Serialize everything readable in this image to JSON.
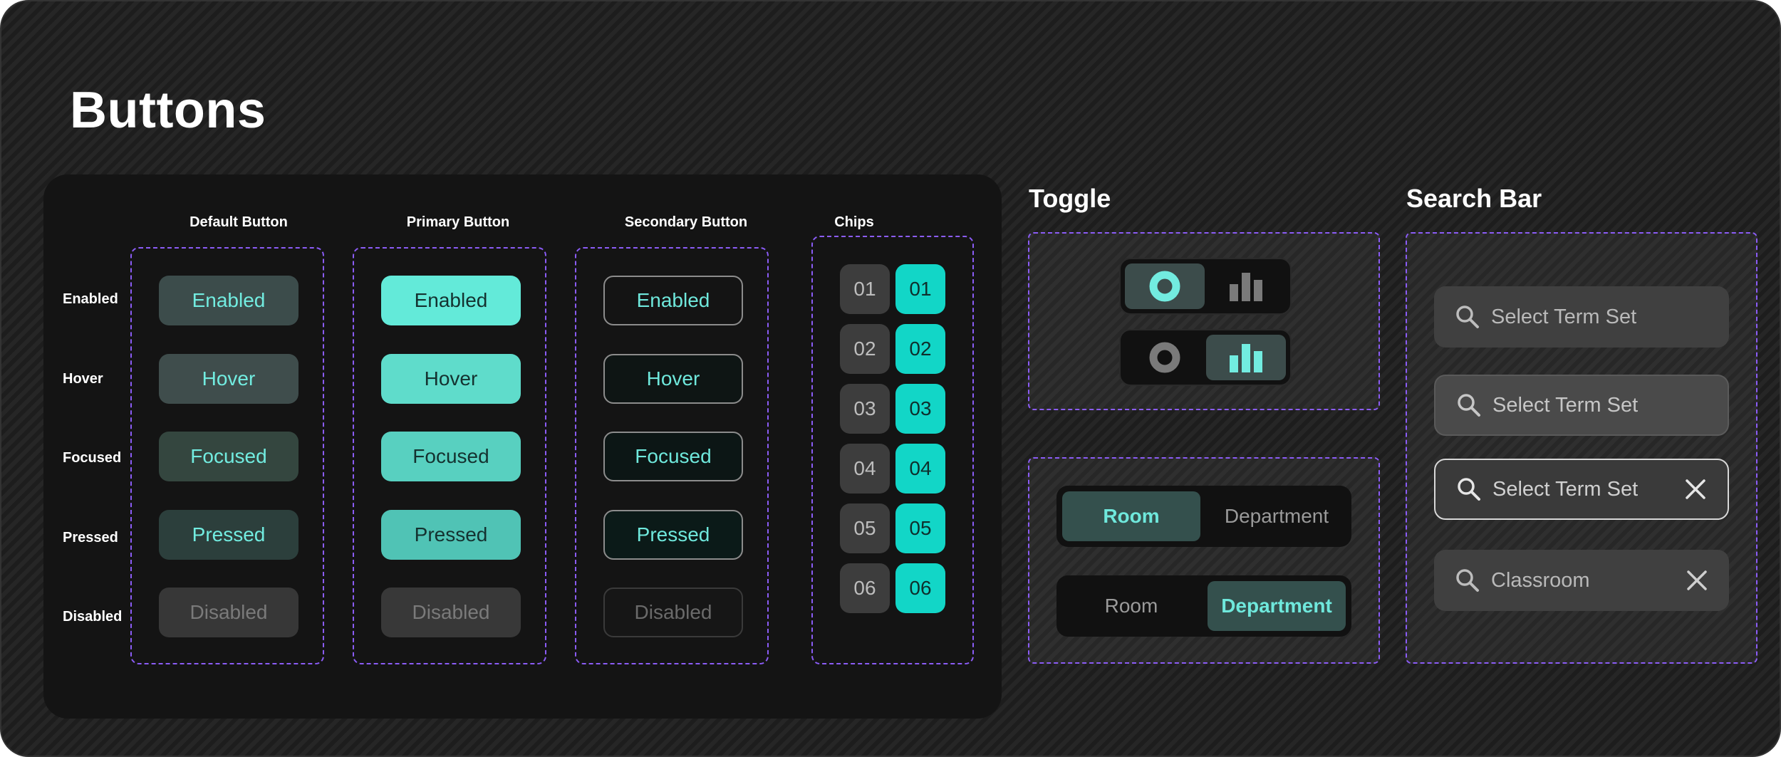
{
  "page": {
    "title": "Buttons"
  },
  "buttons_card": {
    "columns": [
      "Default Button",
      "Primary Button",
      "Secondary Button",
      "Chips"
    ],
    "rows": [
      "Enabled",
      "Hover",
      "Focused",
      "Pressed",
      "Disabled"
    ],
    "default_buttons": [
      "Enabled",
      "Hover",
      "Focused",
      "Pressed",
      "Disabled"
    ],
    "primary_buttons": [
      "Enabled",
      "Hover",
      "Focused",
      "Pressed",
      "Disabled"
    ],
    "secondary_buttons": [
      "Enabled",
      "Hover",
      "Focused",
      "Pressed",
      "Disabled"
    ],
    "chips": [
      "01",
      "02",
      "03",
      "04",
      "05",
      "06"
    ]
  },
  "toggle": {
    "title": "Toggle",
    "icons": [
      "record-icon",
      "bar-chart-icon"
    ],
    "segments": [
      {
        "left": "Room",
        "right": "Department",
        "active": "left"
      },
      {
        "left": "Room",
        "right": "Department",
        "active": "right"
      }
    ]
  },
  "search_bar": {
    "title": "Search Bar",
    "items": [
      {
        "text": "Select Term Set",
        "state": "enabled",
        "clear": false
      },
      {
        "text": "Select Term Set",
        "state": "hover",
        "clear": false
      },
      {
        "text": "Select Term Set",
        "state": "focused",
        "clear": true
      },
      {
        "text": "Classroom",
        "state": "filled",
        "clear": true
      }
    ]
  },
  "colors": {
    "accent": "#63ead9",
    "chip_active": "#12d6c7",
    "dashed_border": "#8b5cf6",
    "background": "#202020"
  }
}
